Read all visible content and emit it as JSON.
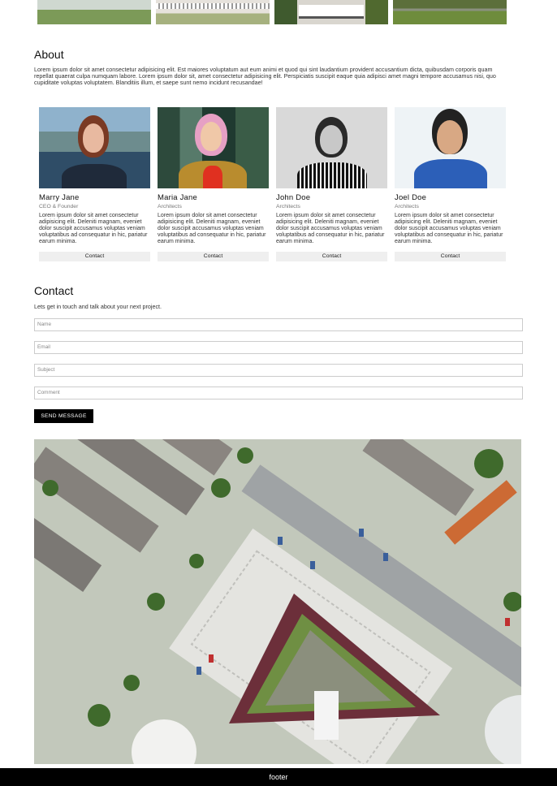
{
  "about": {
    "title": "About",
    "text": "Lorem ipsum dolor sit amet consectetur adipisicing elit. Est maiores voluptatum aut eum animi et quod qui sint laudantium provident accusantium dicta, quibusdam corporis quam repellat quaerat culpa numquam labore. Lorem ipsum dolor sit, amet consectetur adipisicing elit. Perspiciatis suscipit eaque quia adipisci amet magni tempore accusamus nisi, quo cupiditate voluptas voluptatem. Blanditiis illum, et saepe sunt nemo incidunt recusandae!"
  },
  "team": [
    {
      "name": "Marry Jane",
      "role": "CEO & Founder",
      "bio": "Lorem ipsum dolor sit amet consectetur adipisicing elit. Deleniti magnam, eveniet dolor suscipit accusamus voluptas veniam voluptatibus ad consequatur in hic, pariatur earum minima.",
      "button": "Contact"
    },
    {
      "name": "Maria Jane",
      "role": "Architects",
      "bio": "Lorem ipsum dolor sit amet consectetur adipisicing elit. Deleniti magnam, eveniet dolor suscipit accusamus voluptas veniam voluptatibus ad consequatur in hic, pariatur earum minima.",
      "button": "Contact"
    },
    {
      "name": "John Doe",
      "role": "Architects",
      "bio": "Lorem ipsum dolor sit amet consectetur adipisicing elit. Deleniti magnam, eveniet dolor suscipit accusamus voluptas veniam voluptatibus ad consequatur in hic, pariatur earum minima.",
      "button": "Contact"
    },
    {
      "name": "Joel Doe",
      "role": "Architects",
      "bio": "Lorem ipsum dolor sit amet consectetur adipisicing elit. Deleniti magnam, eveniet dolor suscipit accusamus voluptas veniam voluptatibus ad consequatur in hic, pariatur earum minima.",
      "button": "Contact"
    }
  ],
  "contact": {
    "title": "Contact",
    "subtitle": "Lets get in touch and talk about your next project.",
    "fields": {
      "name_placeholder": "Name",
      "email_placeholder": "Email",
      "subject_placeholder": "Subject",
      "comment_placeholder": "Comment"
    },
    "send_label": "SEND MESSAGE"
  },
  "footer": {
    "text": "footer"
  }
}
